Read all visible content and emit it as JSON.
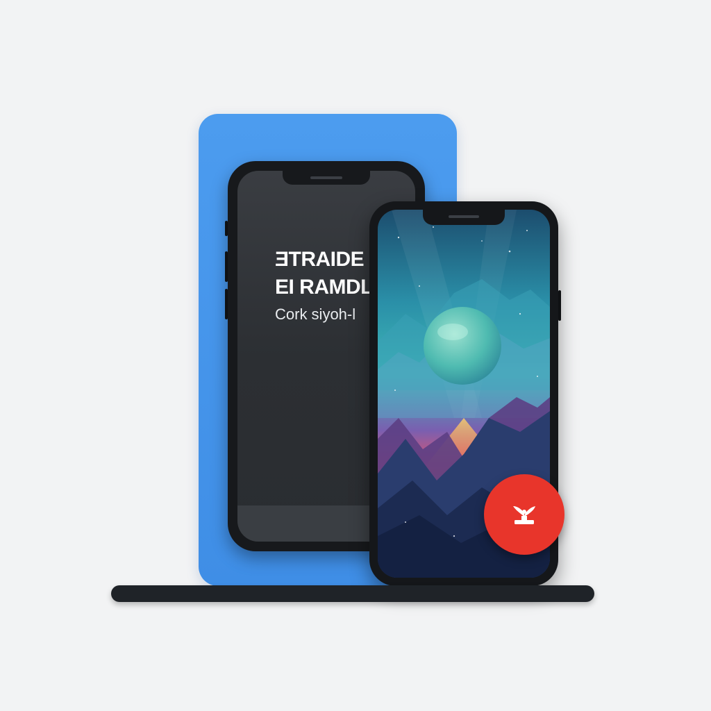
{
  "promo": {
    "line1": "ƎTRAIDE",
    "line2": "EI RAMDLZ",
    "line3": "Cork siyoh-l"
  },
  "colors": {
    "background": "#f2f3f4",
    "card": "#4c9cef",
    "badge": "#e8352b"
  },
  "icons": {
    "badge_icon": "plant-tool-icon"
  }
}
